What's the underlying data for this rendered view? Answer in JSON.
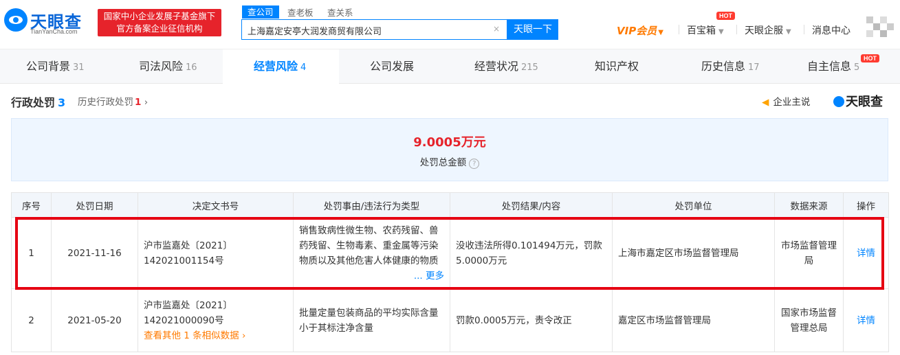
{
  "brand": {
    "name": "天眼查",
    "domain": "TianYanCha.com",
    "badge_line1": "国家中小企业发展子基金旗下",
    "badge_line2": "官方备案企业征信机构"
  },
  "search": {
    "tabs": [
      "查公司",
      "查老板",
      "查关系"
    ],
    "query": "上海嘉定安亭大润发商贸有限公司",
    "button": "天眼一下",
    "clear": "×"
  },
  "topnav": {
    "vip": "VIP会员",
    "baibaoxiang": "百宝箱",
    "hot": "HOT",
    "qifu": "天眼企服",
    "messages": "消息中心"
  },
  "tabs": [
    {
      "label": "公司背景",
      "count": "31"
    },
    {
      "label": "司法风险",
      "count": "16"
    },
    {
      "label": "经营风险",
      "count": "4"
    },
    {
      "label": "公司发展",
      "count": ""
    },
    {
      "label": "经营状况",
      "count": "215"
    },
    {
      "label": "知识产权",
      "count": ""
    },
    {
      "label": "历史信息",
      "count": "17"
    },
    {
      "label": "自主信息",
      "count": "5"
    }
  ],
  "section": {
    "title": "行政处罚",
    "count": "3",
    "history_label": "历史行政处罚",
    "history_count": "1",
    "enterprise_voice": "企业主说",
    "brand": "天眼查"
  },
  "summary": {
    "amount": "9.0005万元",
    "label": "处罚总金额",
    "help": "?"
  },
  "table": {
    "headers": [
      "序号",
      "处罚日期",
      "决定文书号",
      "处罚事由/违法行为类型",
      "处罚结果/内容",
      "处罚单位",
      "数据来源",
      "操作"
    ],
    "rows": [
      {
        "index": "1",
        "date": "2021-11-16",
        "doc_no": "沪市监嘉处〔2021〕142021001154号",
        "reason": "销售致病性微生物、农药残留、兽药残留、生物毒素、重金属等污染物质以及其他危害人体健康的物质含量超过食品安全",
        "more": "... 更多",
        "result": "没收违法所得0.101494万元，罚款5.0000万元",
        "unit": "上海市嘉定区市场监督管理局",
        "source": "市场监督管理局",
        "action": "详情"
      },
      {
        "index": "2",
        "date": "2021-05-20",
        "doc_no": "沪市监嘉处〔2021〕142021000090号",
        "similar": "查看其他 1 条相似数据",
        "reason": "批量定量包装商品的平均实际含量小于其标注净含量",
        "result": "罚款0.0005万元，责令改正",
        "unit": "嘉定区市场监督管理局",
        "source": "国家市场监督管理总局",
        "action": "详情"
      }
    ]
  }
}
